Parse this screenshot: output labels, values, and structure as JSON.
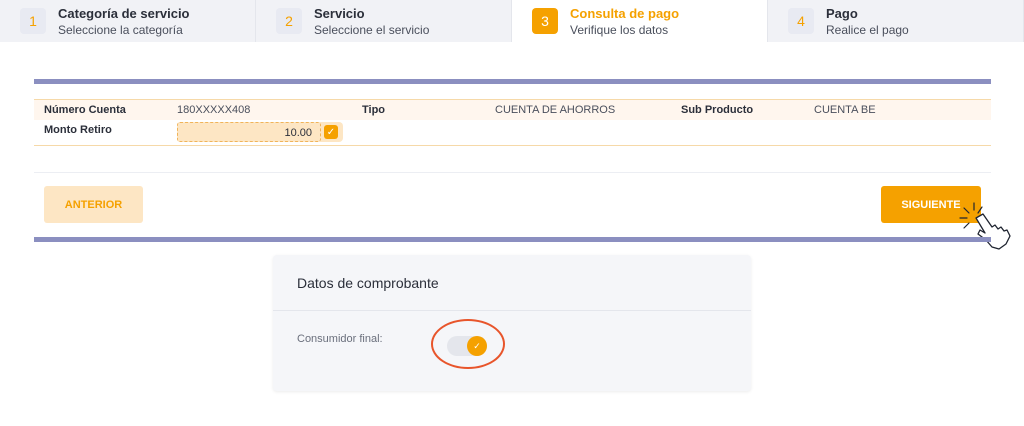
{
  "steps": [
    {
      "num": "1",
      "title": "Categoría de servicio",
      "subtitle": "Seleccione la categoría"
    },
    {
      "num": "2",
      "title": "Servicio",
      "subtitle": "Seleccione el servicio"
    },
    {
      "num": "3",
      "title": "Consulta de pago",
      "subtitle": "Verifique los datos"
    },
    {
      "num": "4",
      "title": "Pago",
      "subtitle": "Realice el pago"
    }
  ],
  "account": {
    "numero_label": "Número Cuenta",
    "numero_value": "180XXXXX408",
    "tipo_label": "Tipo",
    "tipo_value": "CUENTA DE AHORROS",
    "subproducto_label": "Sub Producto",
    "subproducto_value": "CUENTA BE",
    "monto_label": "Monto Retiro",
    "monto_value": "10.00"
  },
  "actions": {
    "prev_label": "ANTERIOR",
    "next_label": "SIGUIENTE"
  },
  "comprobante": {
    "title": "Datos de comprobante",
    "consumidor_label": "Consumidor final:",
    "consumidor_enabled": true
  },
  "colors": {
    "accent": "#f5a100",
    "accent_light": "#fde6c4",
    "rule": "#8b8fc0",
    "highlight_ring": "#e8552b"
  },
  "icons": {
    "check": "check-icon",
    "cursor": "hand-pointer-icon"
  }
}
